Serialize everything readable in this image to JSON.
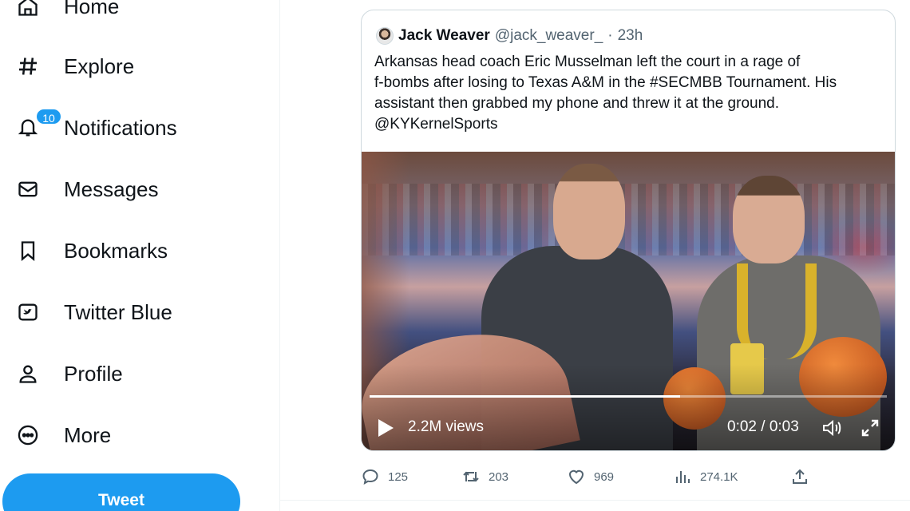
{
  "sidebar": {
    "items": [
      {
        "label": "Home",
        "icon": "home-icon"
      },
      {
        "label": "Explore",
        "icon": "hashtag-icon"
      },
      {
        "label": "Notifications",
        "icon": "bell-icon",
        "badge": "10"
      },
      {
        "label": "Messages",
        "icon": "envelope-icon"
      },
      {
        "label": "Bookmarks",
        "icon": "bookmark-icon"
      },
      {
        "label": "Twitter Blue",
        "icon": "twitter-blue-icon"
      },
      {
        "label": "Profile",
        "icon": "person-icon"
      },
      {
        "label": "More",
        "icon": "more-circle-icon"
      }
    ],
    "tweet_button": "Tweet"
  },
  "quoted_tweet": {
    "author_name": "Jack Weaver",
    "author_handle": "@jack_weaver_",
    "separator": "·",
    "timestamp": "23h",
    "text_lines": [
      "Arkansas head coach Eric Musselman left the court in a rage of",
      "f-bombs after losing to Texas A&M in the #SECMBB Tournament. His",
      "assistant then grabbed my phone and threw it at the ground.",
      "@KYKernelSports"
    ],
    "video": {
      "views": "2.2M views",
      "time": "0:02 / 0:03",
      "progress": 0.6
    }
  },
  "actions": {
    "replies": "125",
    "retweets": "203",
    "likes": "969",
    "views": "274.1K"
  },
  "colors": {
    "accent": "#1d9bf0",
    "text": "#0f1419",
    "muted": "#536471",
    "border": "#cfd9de"
  }
}
